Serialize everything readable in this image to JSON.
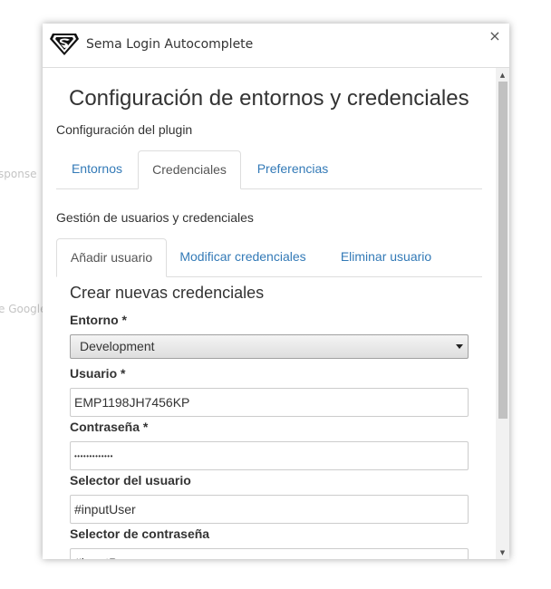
{
  "background": {
    "snippet_1": "sponse",
    "snippet_2": "e Google"
  },
  "window": {
    "title": "Sema Login Autocomplete",
    "logo_icon": "superman-shield-icon",
    "close_label": "×"
  },
  "page": {
    "title": "Configuración de entornos y credenciales",
    "plugin_config": "Configuración del plugin"
  },
  "main_tabs": [
    {
      "label": "Entornos",
      "active": false
    },
    {
      "label": "Credenciales",
      "active": true
    },
    {
      "label": "Preferencias",
      "active": false
    }
  ],
  "credentials": {
    "heading": "Gestión de usuarios y credenciales",
    "tabs": [
      {
        "label": "Añadir usuario",
        "active": true
      },
      {
        "label": "Modificar credenciales",
        "active": false
      },
      {
        "label": "Eliminar usuario",
        "active": false
      }
    ]
  },
  "form": {
    "title": "Crear nuevas credenciales",
    "environment_label": "Entorno *",
    "environment_value": "Development",
    "user_label": "Usuario *",
    "user_value": "EMP1198JH7456KP",
    "password_label": "Contraseña *",
    "password_mask": "•••••••••••••",
    "user_selector_label": "Selector del usuario",
    "user_selector_value": "#inputUser",
    "password_selector_label": "Selector de contraseña",
    "password_selector_value": "#inputPass"
  },
  "colors": {
    "link": "#337ab7",
    "text": "#333333",
    "border": "#dddddd"
  }
}
